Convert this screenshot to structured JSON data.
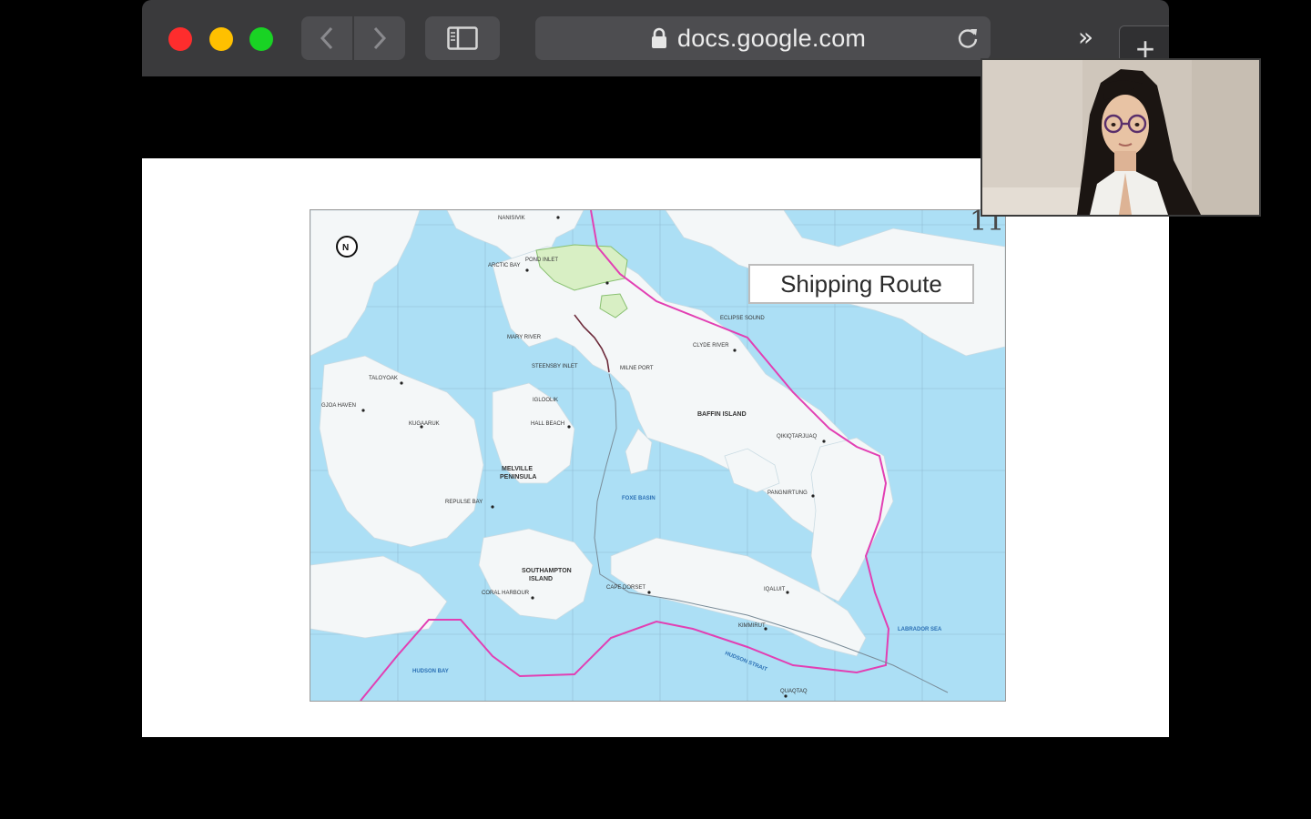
{
  "browser": {
    "url": "docs.google.com",
    "icons": {
      "back": "chevron-left-icon",
      "forward": "chevron-right-icon",
      "sidebar": "sidebar-icon",
      "lock": "lock-icon",
      "reload": "reload-icon",
      "more": "double-chevron-right-icon",
      "new_tab": "plus-icon"
    },
    "more_glyph": "»",
    "new_tab_glyph": "+",
    "traffic_lights": [
      "#fe2d2d",
      "#ffc000",
      "#19d324"
    ]
  },
  "slide": {
    "label": "Shipping Route",
    "page_number": "11",
    "route_color": "#e23fb3",
    "map_labels": {
      "baffin_island": "BAFFIN ISLAND",
      "foxe_basin": "FOXE BASIN",
      "southampton": "SOUTHAMPTON",
      "island": "ISLAND",
      "melville": "MELVILLE",
      "peninsula": "PENINSULA",
      "hudson_bay": "HUDSON BAY",
      "labrador_sea": "LABRADOR SEA",
      "hudson_strait": "HUDSON STRAIT",
      "coral_harbour": "CORAL HARBOUR",
      "hall_beach": "HALL BEACH",
      "cape_dorset": "CAPE DORSET",
      "kimmirut": "KIMMIRUT",
      "iqaluit": "IQALUIT",
      "pangnirtung": "PANGNIRTUNG",
      "qikiqtarjuaq": "QIKIQTARJUAQ",
      "clyde_river": "CLYDE RIVER",
      "igloolik": "IGLOOLIK",
      "repulse_bay": "REPULSE BAY",
      "kugaaruk": "KUGAARUK",
      "arctic_bay": "ARCTIC BAY",
      "pond_inlet": "POND INLET",
      "steensby_inlet": "STEENSBY INLET",
      "mary_river": "MARY RIVER",
      "milne_port": "MILNE PORT",
      "gjoa_haven": "GJOA HAVEN",
      "taloyoak": "TALOYOAK",
      "quaqtaq": "QUAQTAQ",
      "nanisivik": "NANISIVIK",
      "eclipse_sound": "ECLIPSE SOUND"
    }
  },
  "video": {
    "participant_icon": "webcam-participant",
    "wall_color": "#cfc6bb",
    "hair_color": "#1b1512",
    "shirt_color": "#f1f0ec"
  }
}
